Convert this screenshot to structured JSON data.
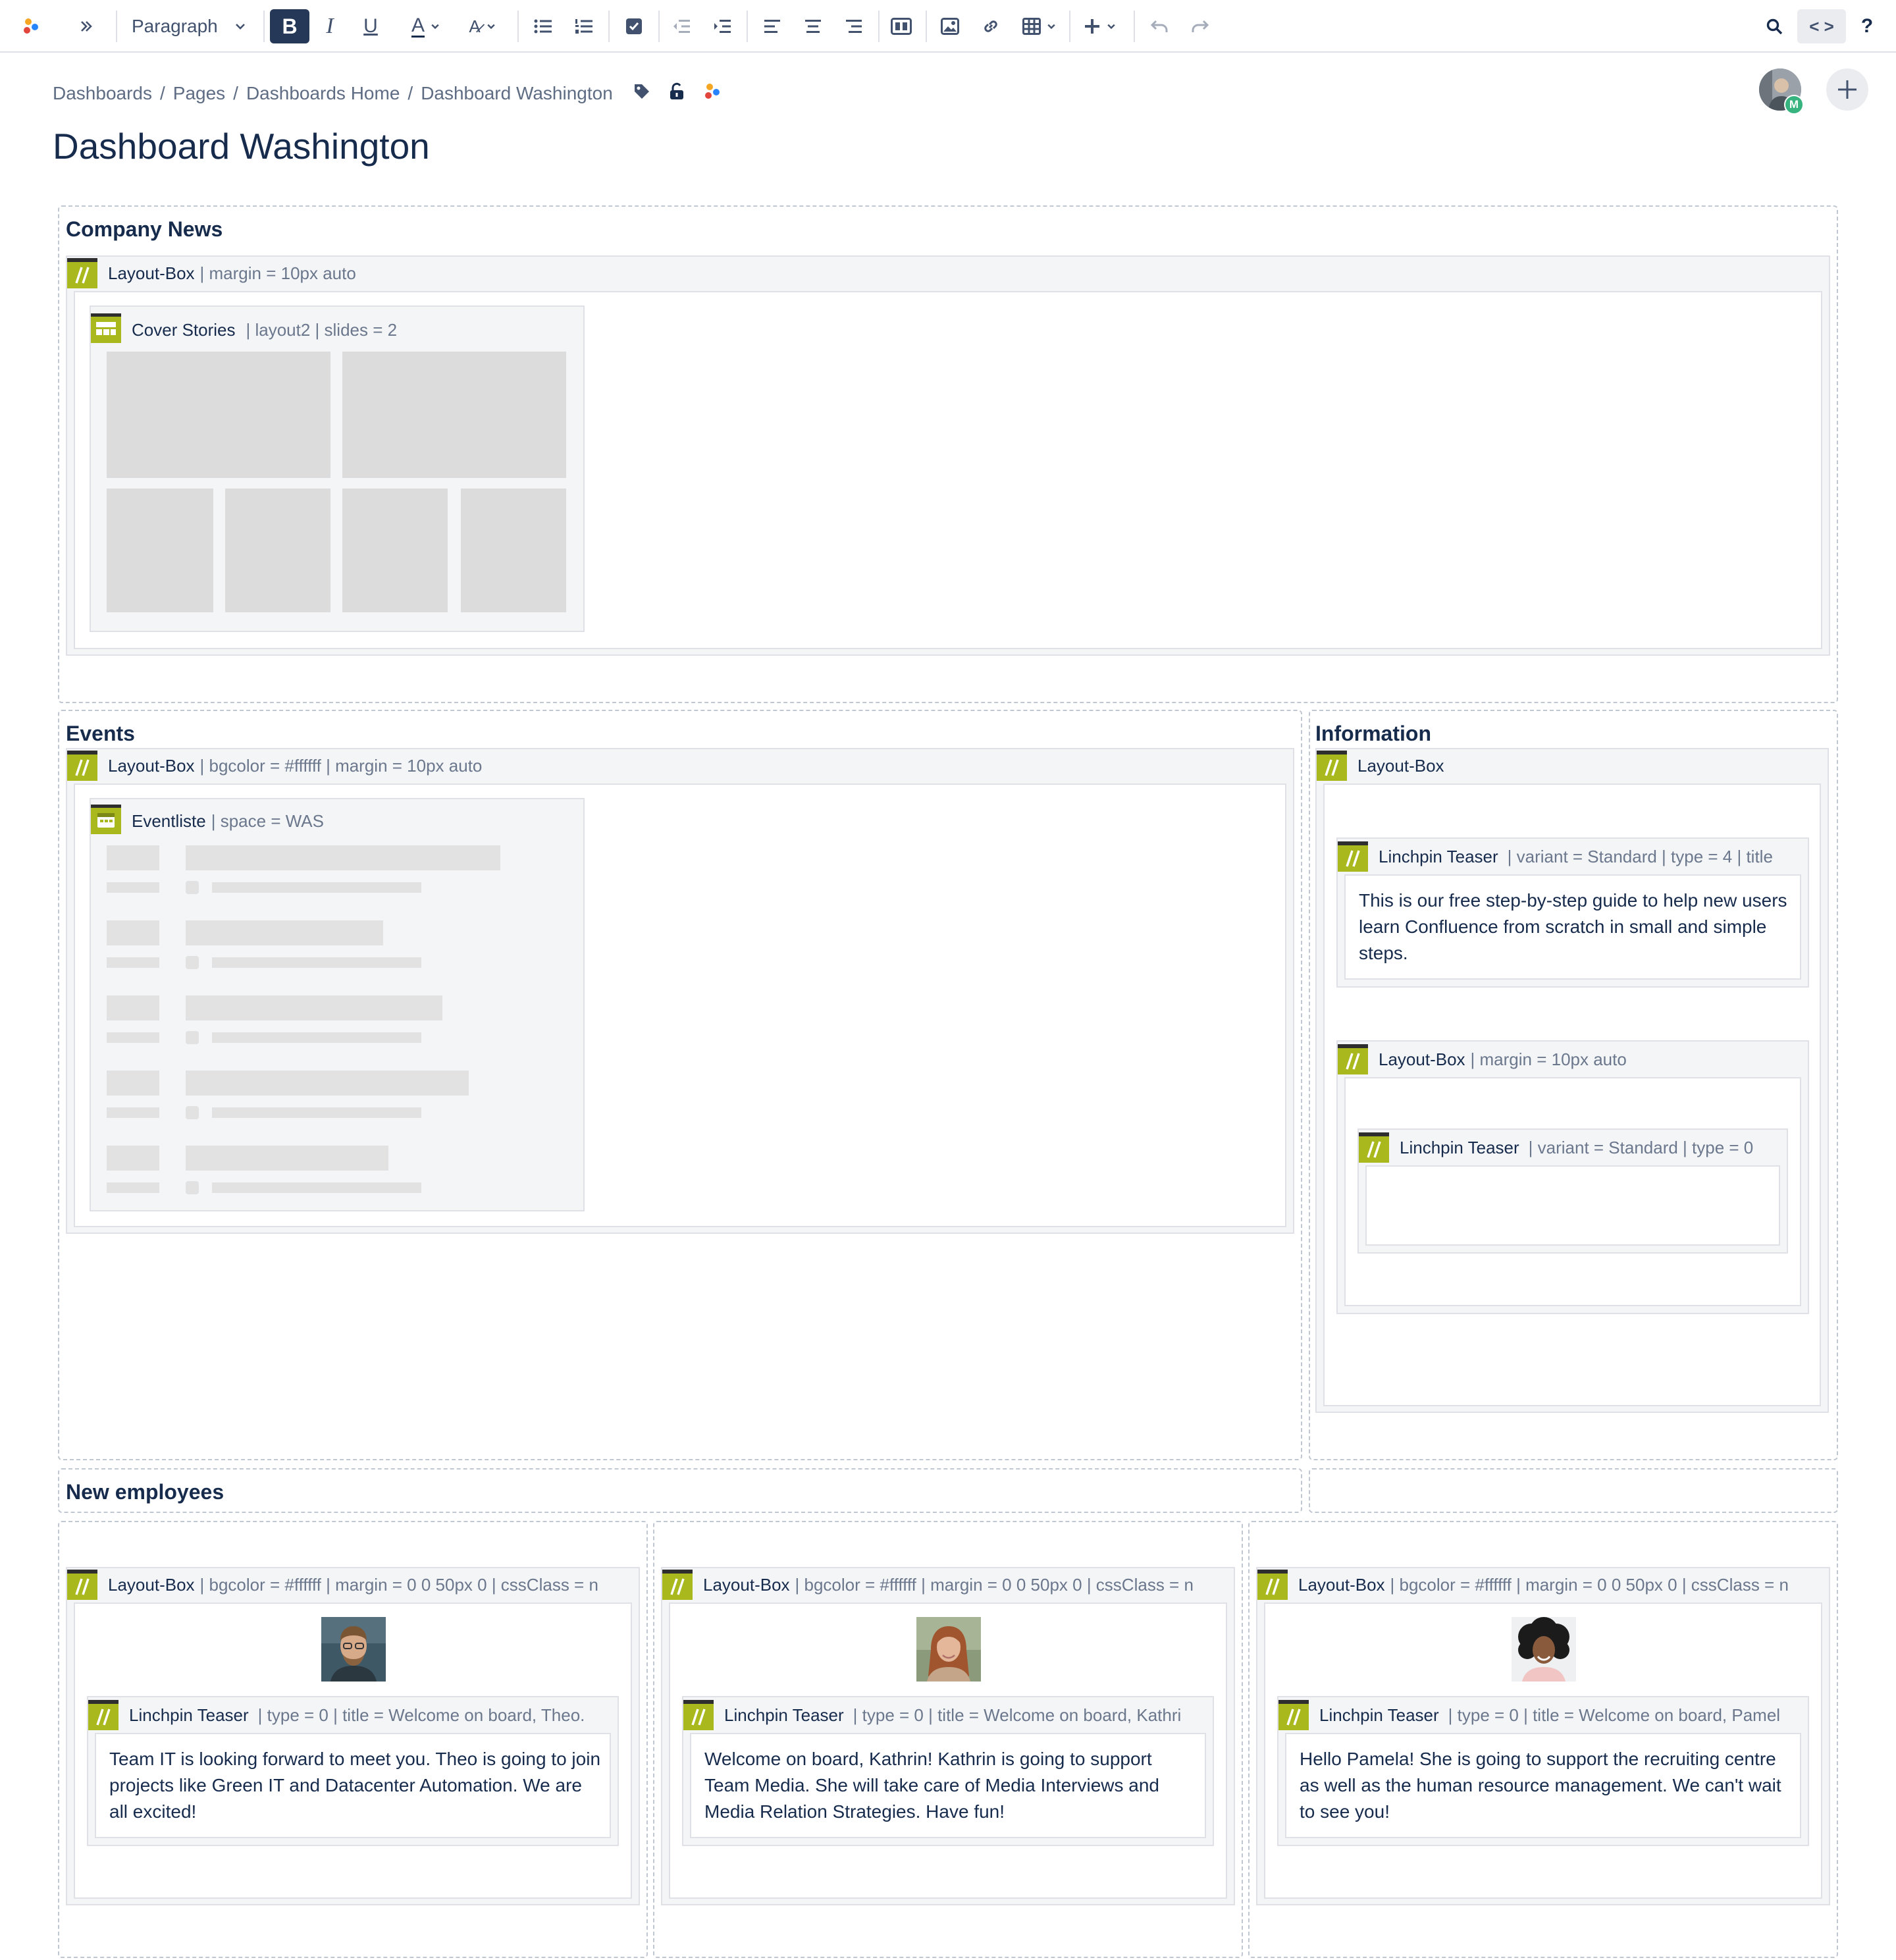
{
  "toolbar": {
    "paragraph_label": "Paragraph",
    "icons": [
      "app-logo-icon",
      "expand-icon",
      "bold-icon",
      "italic-icon",
      "underline-icon",
      "text-color-icon",
      "clear-format-icon",
      "bullet-list-icon",
      "numbered-list-icon",
      "task-icon",
      "outdent-icon",
      "indent-icon",
      "align-left-icon",
      "align-center-icon",
      "align-right-icon",
      "layout-icon",
      "image-icon",
      "link-icon",
      "table-icon",
      "insert-icon",
      "undo-icon",
      "redo-icon",
      "search-icon",
      "code-icon",
      "help-icon"
    ],
    "code_toggle_label": "< >",
    "help_label": "?"
  },
  "breadcrumb": [
    "Dashboards",
    "Pages",
    "Dashboards Home",
    "Dashboard Washington"
  ],
  "breadcrumb_separator": "/",
  "page_title": "Dashboard Washington",
  "avatar": {
    "badge": "M"
  },
  "colors": {
    "macro_accent": "#a9b81d",
    "toolbar_active": "#253858",
    "link_muted": "#5e6c84"
  },
  "sections": {
    "company_news": {
      "title": "Company News",
      "layout_box": {
        "name": "Layout-Box",
        "params": "| margin = 10px auto"
      },
      "cover_stories": {
        "name": "Cover Stories",
        "params": "| layout2 | slides = 2"
      }
    },
    "events": {
      "title": "Events",
      "layout_box": {
        "name": "Layout-Box",
        "params": "| bgcolor = #ffffff | margin = 10px auto"
      },
      "eventliste": {
        "name": "Eventliste",
        "params": "| space = WAS"
      }
    },
    "information": {
      "title": "Information",
      "layout_box": {
        "name": "Layout-Box",
        "params": ""
      },
      "teaser1": {
        "name": "Linchpin Teaser",
        "params": "| variant = Standard | type = 4 | title",
        "text": "This is our free step-by-step guide to help new users learn Confluence from scratch in small and simple steps."
      },
      "inner_layout_box": {
        "name": "Layout-Box",
        "params": "| margin = 10px auto"
      },
      "teaser2": {
        "name": "Linchpin Teaser",
        "params": "| variant = Standard | type = 0"
      }
    },
    "new_employees": {
      "title": "New employees",
      "columns": [
        {
          "layout_box": {
            "name": "Layout-Box",
            "params": "| bgcolor = #ffffff | margin = 0 0 50px 0 | cssClass = n"
          },
          "teaser": {
            "name": "Linchpin Teaser",
            "params": "| type = 0 | title = Welcome on board, Theo.",
            "text": "Team IT is looking forward to meet you. Theo is going to join projects like Green IT and Datacenter Automation. We are all excited!"
          }
        },
        {
          "layout_box": {
            "name": "Layout-Box",
            "params": "| bgcolor = #ffffff | margin = 0 0 50px 0 | cssClass = n"
          },
          "teaser": {
            "name": "Linchpin Teaser",
            "params": "| type = 0 | title = Welcome on board, Kathri",
            "text": "Welcome on board, Kathrin! Kathrin is going to support Team Media. She will take care of Media Interviews and Media Relation Strategies. Have fun!"
          }
        },
        {
          "layout_box": {
            "name": "Layout-Box",
            "params": "| bgcolor = #ffffff | margin = 0 0 50px 0 | cssClass = n"
          },
          "teaser": {
            "name": "Linchpin Teaser",
            "params": "| type = 0 | title = Welcome on board, Pamel",
            "text": "Hello Pamela! She is going to support the recruiting centre as well as the human resource management. We can't wait to see you!"
          }
        }
      ]
    }
  }
}
